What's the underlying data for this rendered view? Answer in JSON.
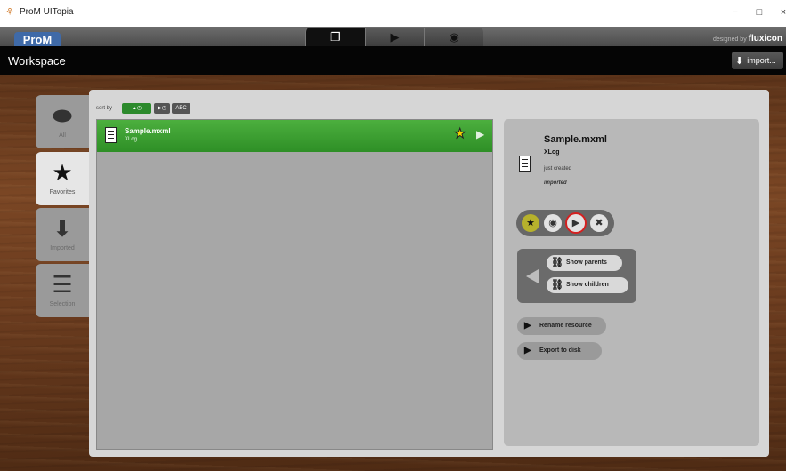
{
  "window": {
    "title": "ProM UITopia",
    "controls": {
      "minimize": "−",
      "maximize": "□",
      "close": "×"
    }
  },
  "header": {
    "logo": "ProM",
    "view_switch": [
      {
        "icon": "workspace-icon",
        "glyph": "❐",
        "active": true
      },
      {
        "icon": "play-icon",
        "glyph": "▶",
        "active": false
      },
      {
        "icon": "eye-icon",
        "glyph": "◉",
        "active": false
      }
    ],
    "designed_by": "designed by",
    "brand": "fluxicon"
  },
  "workspace": {
    "title": "Workspace",
    "import_label": "import..."
  },
  "tabs": [
    {
      "label": "All",
      "icon": "database-icon",
      "glyph": "⬬",
      "active": false
    },
    {
      "label": "Favorites",
      "icon": "star-icon",
      "glyph": "★",
      "active": true
    },
    {
      "label": "Imported",
      "icon": "import-icon",
      "glyph": "⬇",
      "active": false
    },
    {
      "label": "Selection",
      "icon": "selection-icon",
      "glyph": "☰",
      "active": false
    }
  ],
  "sort": {
    "label": "sort by",
    "options": [
      {
        "label": "▲◷",
        "active": true
      },
      {
        "label": "▶◷",
        "active": false
      },
      {
        "label": "ABC",
        "active": false
      }
    ]
  },
  "resources": [
    {
      "name": "Sample.mxml",
      "type": "XLog",
      "favorite": true
    }
  ],
  "details": {
    "name": "Sample.mxml",
    "type": "XLog",
    "created": "just created",
    "origin": "imported",
    "show_parents": "Show parents",
    "show_children": "Show children",
    "rename": "Rename resource",
    "export": "Export to disk"
  },
  "colors": {
    "accent_green": "#3aa030",
    "brand_blue": "#3f6aa8",
    "highlight_red": "#d42020"
  }
}
